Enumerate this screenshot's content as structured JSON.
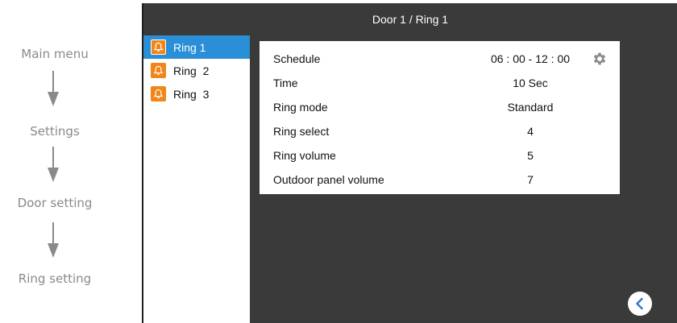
{
  "flow": {
    "steps": [
      "Main menu",
      "Settings",
      "Door setting",
      "Ring setting"
    ]
  },
  "header": {
    "title": "Door 1 / Ring 1"
  },
  "sidebar": {
    "items": [
      {
        "label": "Ring 1",
        "icon": "bell-icon",
        "active": true
      },
      {
        "label": "Ring  2",
        "icon": "bell-icon",
        "active": false
      },
      {
        "label": "Ring  3",
        "icon": "bell-icon",
        "active": false
      }
    ]
  },
  "settings": {
    "rows": [
      {
        "label": "Schedule",
        "value": "06 : 00 - 12 : 00",
        "icon": "gear-icon"
      },
      {
        "label": "Time",
        "value": "10 Sec"
      },
      {
        "label": "Ring mode",
        "value": "Standard"
      },
      {
        "label": "Ring select",
        "value": "4"
      },
      {
        "label": "Ring volume",
        "value": "5"
      },
      {
        "label": "Outdoor panel volume",
        "value": "7"
      }
    ]
  },
  "controls": {
    "back_icon": "chevron-left-icon"
  },
  "colors": {
    "screen_bg": "#3a3a3a",
    "active_item": "#2a8fd6",
    "bell": "#f0861a",
    "back_chevron": "#3b6fd4",
    "flow_text": "#8a8a8a"
  }
}
